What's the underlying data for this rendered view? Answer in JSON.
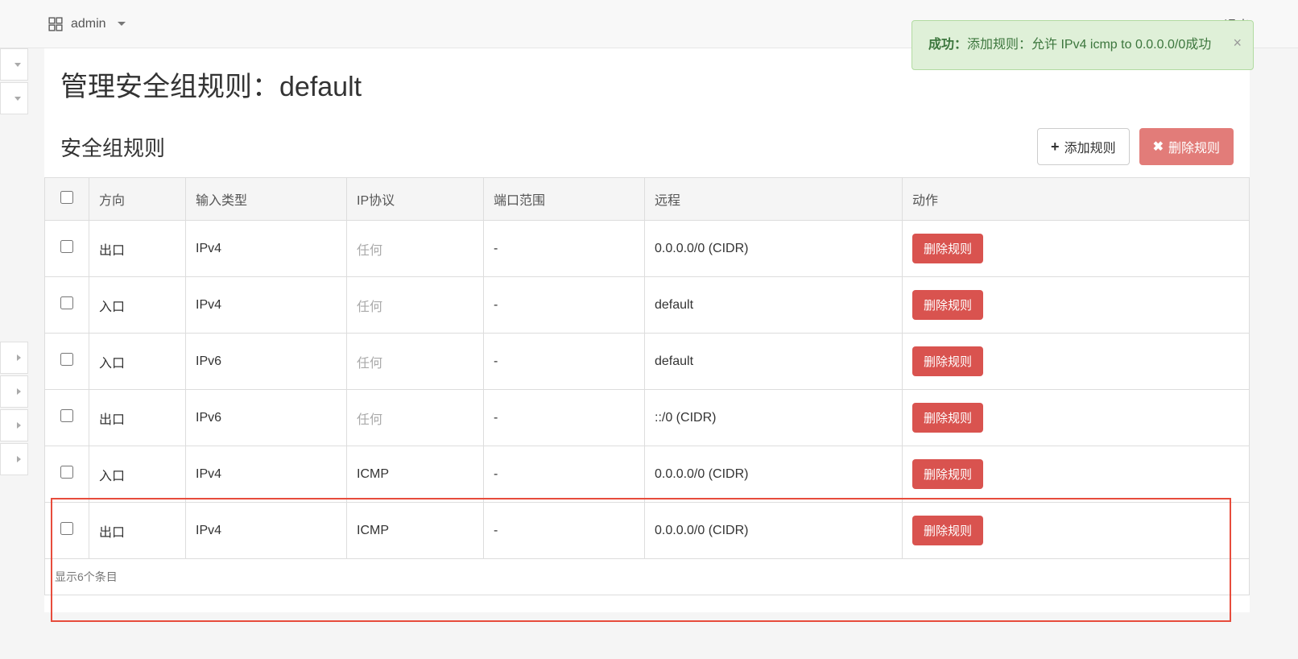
{
  "topbar": {
    "project_name": "admin",
    "logout": "退出"
  },
  "page": {
    "title_prefix": "管理安全组规则：",
    "title_name": "default"
  },
  "section": {
    "title": "安全组规则",
    "add_rule_label": "添加规则",
    "delete_rule_label": "删除规则"
  },
  "table": {
    "headers": {
      "direction": "方向",
      "input_type": "输入类型",
      "ip_protocol": "IP协议",
      "port_range": "端口范围",
      "remote": "远程",
      "action": "动作"
    },
    "rows": [
      {
        "direction": "出口",
        "type": "IPv4",
        "protocol": "任何",
        "protocol_muted": true,
        "port": "-",
        "remote": "0.0.0.0/0 (CIDR)"
      },
      {
        "direction": "入口",
        "type": "IPv4",
        "protocol": "任何",
        "protocol_muted": true,
        "port": "-",
        "remote": "default"
      },
      {
        "direction": "入口",
        "type": "IPv6",
        "protocol": "任何",
        "protocol_muted": true,
        "port": "-",
        "remote": "default"
      },
      {
        "direction": "出口",
        "type": "IPv6",
        "protocol": "任何",
        "protocol_muted": true,
        "port": "-",
        "remote": "::/0 (CIDR)"
      },
      {
        "direction": "入口",
        "type": "IPv4",
        "protocol": "ICMP",
        "protocol_muted": false,
        "port": "-",
        "remote": "0.0.0.0/0 (CIDR)"
      },
      {
        "direction": "出口",
        "type": "IPv4",
        "protocol": "ICMP",
        "protocol_muted": false,
        "port": "-",
        "remote": "0.0.0.0/0 (CIDR)"
      }
    ],
    "delete_button_label": "删除规则",
    "footer": "显示6个条目"
  },
  "alert": {
    "title": "成功：",
    "message": "添加规则：允许 IPv4 icmp to 0.0.0.0/0成功"
  }
}
